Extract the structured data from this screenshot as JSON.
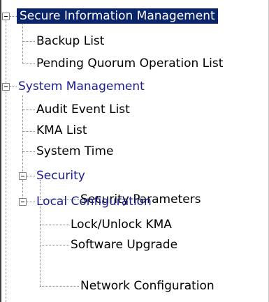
{
  "tree": {
    "secure_information_management": {
      "label": "Secure Information Management",
      "children": [
        "Backup List",
        "Pending Quorum Operation List"
      ]
    },
    "system_management": {
      "label": "System Management",
      "children": [
        "Audit Event List",
        "KMA List",
        "System Time"
      ],
      "security": {
        "label": "Security",
        "children": [
          "Security Parameters"
        ]
      },
      "local_configuration": {
        "label": "Local Configuration",
        "children": [
          "Lock/Unlock KMA",
          "Software Upgrade",
          "Network Configuration"
        ]
      }
    }
  },
  "colors": {
    "selected_background": "#0a246a",
    "selected_text": "#ffffff",
    "folder_text": "#1c1c8c",
    "leaf_text": "#000000",
    "connector": "#808080"
  }
}
